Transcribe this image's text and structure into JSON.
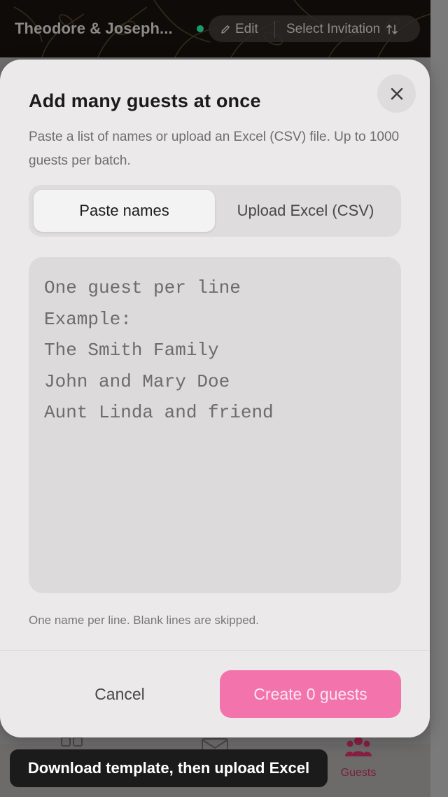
{
  "header": {
    "event_title": "Theodore & Joseph...",
    "edit_label": "Edit",
    "select_label": "Select Invitation"
  },
  "modal": {
    "title": "Add many guests at once",
    "description": "Paste a list of names or upload an Excel (CSV) file. Up to 1000 guests per batch.",
    "tabs": [
      {
        "label": "Paste names",
        "active": true
      },
      {
        "label": "Upload Excel (CSV)",
        "active": false
      }
    ],
    "textarea": {
      "value": "",
      "placeholder": "One guest per line\nExample:\nThe Smith Family\nJohn and Mary Doe\nAunt Linda and friend"
    },
    "hint": "One name per line. Blank lines are skipped.",
    "cancel_label": "Cancel",
    "create_label": "Create 0 guests"
  },
  "bottom_nav": {
    "guests_label": "Guests"
  },
  "toast": {
    "message": "Download template, then upload Excel"
  },
  "colors": {
    "accent": "#f373ac",
    "active_nav": "#7a1c3c",
    "status_online": "#1a9a6c"
  }
}
